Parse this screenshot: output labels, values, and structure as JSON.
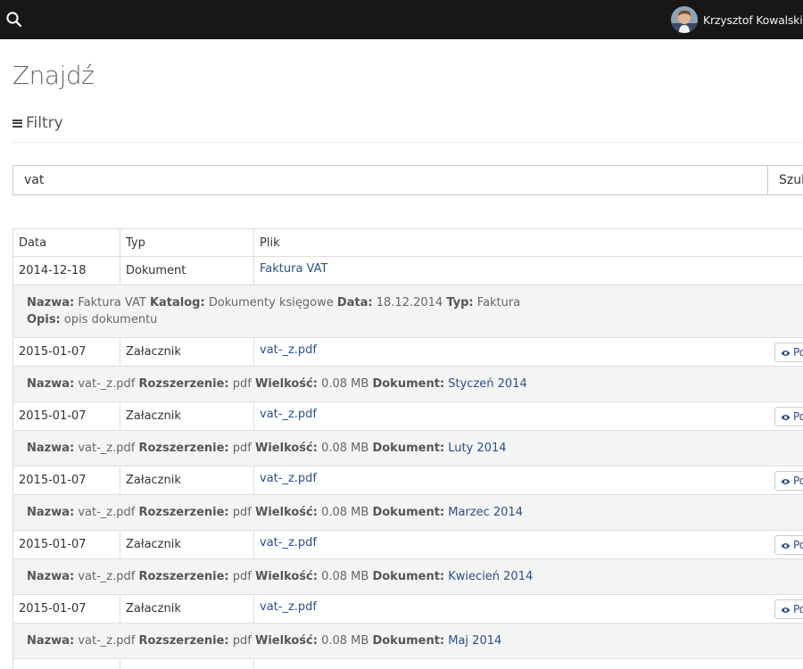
{
  "header": {
    "user_name": "Krzysztof Kowalski",
    "icons": {
      "search": "search-icon",
      "avatar": "avatar"
    }
  },
  "page": {
    "title": "Znajdź",
    "filters_label": "Filtry"
  },
  "search": {
    "value": "vat",
    "button_label": "Szukaj"
  },
  "table": {
    "columns": [
      "Data",
      "Typ",
      "Plik"
    ],
    "preview_label": "Podgląd",
    "document_row": {
      "date": "2014-12-18",
      "type": "Dokument",
      "file": "Faktura VAT",
      "details": {
        "name_label": "Nazwa:",
        "name": "Faktura VAT",
        "catalog_label": "Katalog:",
        "catalog": "Dokumenty księgowe",
        "date_label": "Data:",
        "date": "18.12.2014",
        "type_label": "Typ:",
        "type": "Faktura",
        "desc_label": "Opis:",
        "desc": "opis dokumentu"
      }
    },
    "detail_labels": {
      "name": "Nazwa:",
      "ext": "Rozszerzenie:",
      "size": "Wielkość:",
      "doc": "Dokument:"
    },
    "attachments": [
      {
        "date": "2015-01-07",
        "type": "Załacznik",
        "file": "vat-_z.pdf",
        "name": "vat-_z.pdf",
        "ext": "pdf",
        "size": "0.08 MB",
        "document": "Styczeń 2014"
      },
      {
        "date": "2015-01-07",
        "type": "Załacznik",
        "file": "vat-_z.pdf",
        "name": "vat-_z.pdf",
        "ext": "pdf",
        "size": "0.08 MB",
        "document": "Luty 2014"
      },
      {
        "date": "2015-01-07",
        "type": "Załacznik",
        "file": "vat-_z.pdf",
        "name": "vat-_z.pdf",
        "ext": "pdf",
        "size": "0.08 MB",
        "document": "Marzec 2014"
      },
      {
        "date": "2015-01-07",
        "type": "Załacznik",
        "file": "vat-_z.pdf",
        "name": "vat-_z.pdf",
        "ext": "pdf",
        "size": "0.08 MB",
        "document": "Kwiecień 2014"
      },
      {
        "date": "2015-01-07",
        "type": "Załacznik",
        "file": "vat-_z.pdf",
        "name": "vat-_z.pdf",
        "ext": "pdf",
        "size": "0.08 MB",
        "document": "Maj 2014"
      }
    ]
  },
  "colors": {
    "topbar": "#171717",
    "link": "#2a4f8a",
    "detail_bg": "#f4f4f4",
    "border": "#dddddd"
  }
}
